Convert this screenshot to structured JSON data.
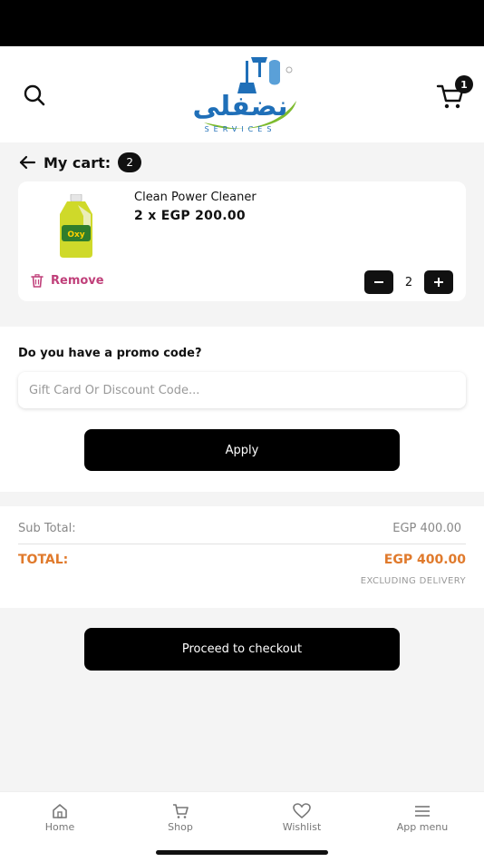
{
  "header": {
    "logo_text": "نضفلى",
    "logo_sub": "SERVICES",
    "cart_badge": "1"
  },
  "cart": {
    "title": "My cart:",
    "count": "2",
    "items": [
      {
        "name": "Clean Power Cleaner",
        "product_label": "Oxy",
        "price_line": "2 x EGP 200.00",
        "remove_label": "Remove",
        "quantity": "2"
      }
    ]
  },
  "promo": {
    "label": "Do you have a promo code?",
    "placeholder": "Gift Card Or Discount Code...",
    "value": "",
    "apply_label": "Apply"
  },
  "totals": {
    "subtotal_label": "Sub Total:",
    "subtotal_value": "EGP 400.00",
    "total_label": "TOTAL:",
    "total_value": "EGP 400.00",
    "delivery_note": "EXCLUDING DELIVERY"
  },
  "checkout_label": "Proceed to checkout",
  "nav": {
    "items": [
      {
        "label": "Home",
        "icon": "home-icon"
      },
      {
        "label": "Shop",
        "icon": "cart-icon"
      },
      {
        "label": "Wishlist",
        "icon": "heart-icon"
      },
      {
        "label": "App menu",
        "icon": "menu-icon"
      }
    ]
  },
  "colors": {
    "accent": "#e07a2c",
    "remove": "#c0407a",
    "logo_blue": "#1f6fb8",
    "logo_green": "#7dbb2e",
    "dark": "#000000"
  }
}
